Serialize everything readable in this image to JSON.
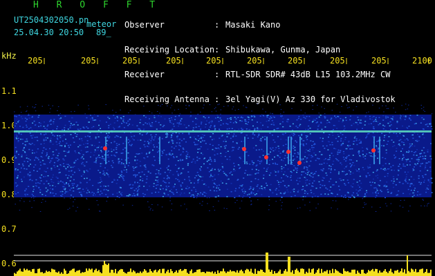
{
  "app": {
    "title": "H R O F F T",
    "file_name": "UT2504302050.pn",
    "mode_label": "meteor",
    "datetime": "25.04.30 20:50",
    "count": "89_"
  },
  "header": {
    "rows": [
      {
        "label": "Observer",
        "value": "Masaki Kano"
      },
      {
        "label": "Receiving Location",
        "value": "Shibukawa, Gunma, Japan"
      },
      {
        "label": "Receiver",
        "value": "RTL-SDR SDR# 43dB L15 103.2MHz CW"
      },
      {
        "label": "Receiving Antenna",
        "value": "3el Yagi(V) Az 330 for Vladivostok"
      }
    ]
  },
  "plot": {
    "unit_label": "kHz",
    "time_labels": [
      "205",
      "205",
      "205",
      "205",
      "205",
      "205",
      "205",
      "205",
      "205",
      "2100"
    ],
    "freq_labels": [
      "1.1",
      "1.0",
      "0.9",
      "0.8",
      "0.7",
      "0.6"
    ],
    "colors": {
      "background": "#000000",
      "noise_dark": "#0a1a8a",
      "noise_mid": "#1f4fd8",
      "noise_light": "#3aa0e8",
      "carrier": "#5fe0c0",
      "echo": "#ff3030",
      "histogram": "#f5e020",
      "reference_line": "#e8e8e8"
    }
  }
}
